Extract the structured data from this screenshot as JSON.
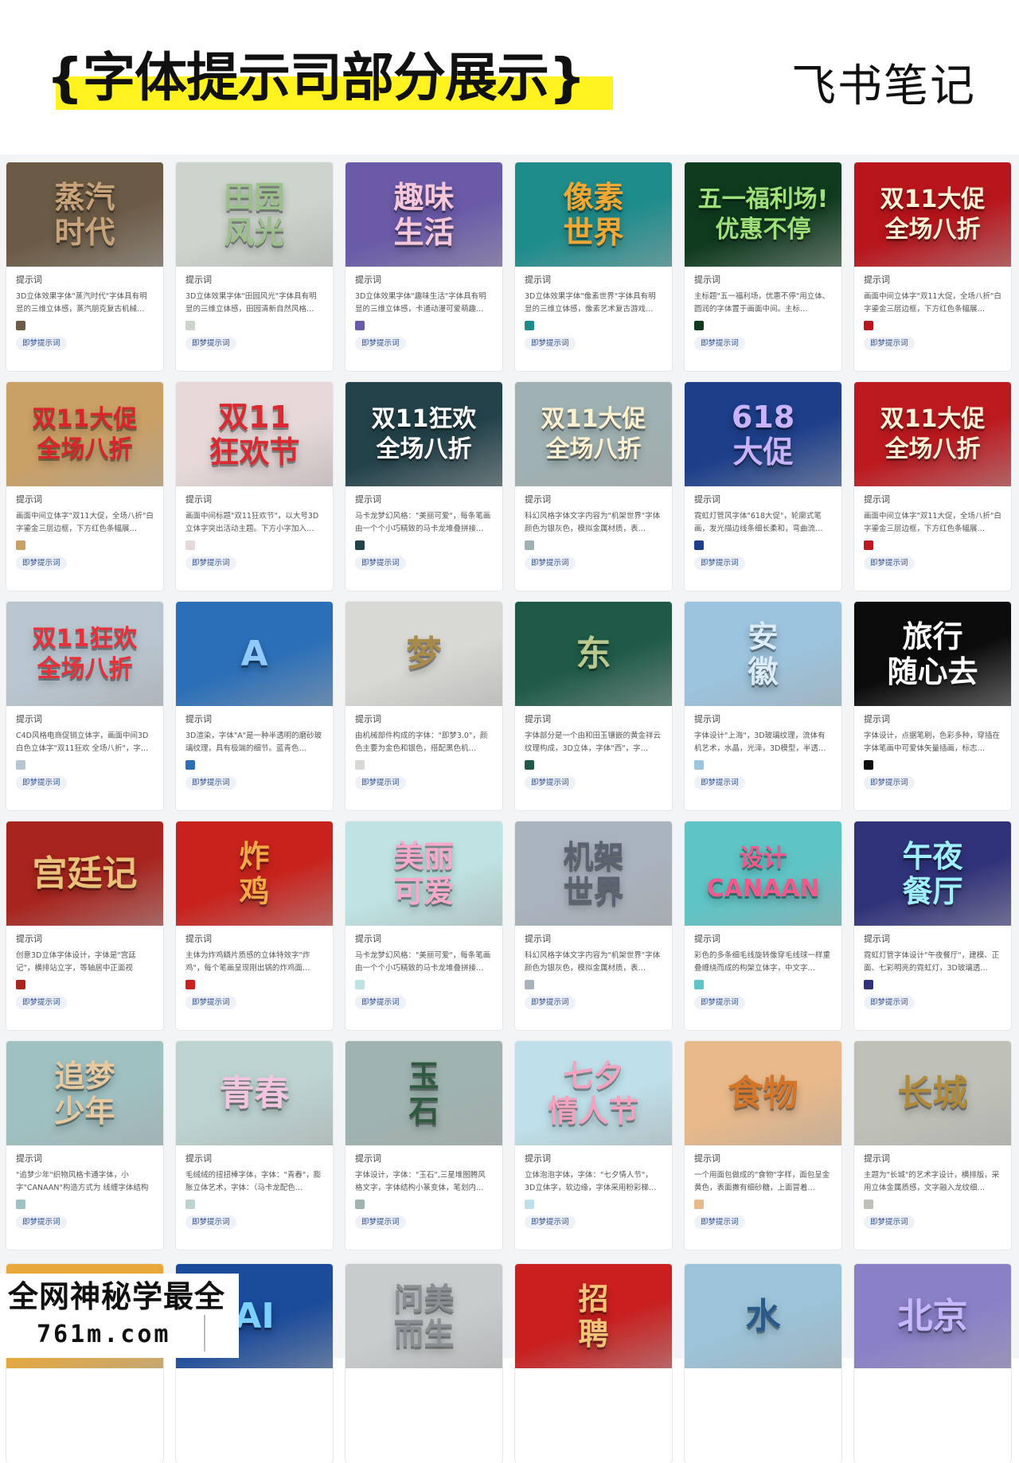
{
  "header": {
    "title": "{字体提示司部分展示}",
    "brand": "飞书笔记"
  },
  "card_label": "提示词",
  "tag_label": "即梦提示词",
  "cards": [
    {
      "thumb": "蒸汽\n时代",
      "bg": "#6b5a45",
      "fg": "#c9a37a",
      "desc": "3D立体效果字体\"蒸汽时代\"字体具有明显的三维立体感，蒸汽朋克复古机械…"
    },
    {
      "thumb": "田园\n风光",
      "bg": "#cdd4cc",
      "fg": "#9cc08c",
      "desc": "3D立体效果字体\"田园风光\"字体具有明显的三维立体感，田园清新自然风格…"
    },
    {
      "thumb": "趣味\n生活",
      "bg": "#6a5aa8",
      "fg": "#f6c7d8",
      "desc": "3D立体效果字体\"趣味生活\"字体具有明显的三维立体感，卡通动漫可爱萌趣…"
    },
    {
      "thumb": "像素\n世界",
      "bg": "#1f8c8c",
      "fg": "#f2a934",
      "desc": "3D立体效果字体\"像素世界\"字体具有明显的三维立体感，像素艺术复古游戏…"
    },
    {
      "thumb": "五一福利场!\n优惠不停",
      "bg": "#0f3a1e",
      "fg": "#9fe07a",
      "desc": "主标题\"五一福利场，优惠不停\"用立体、圆润的字体置于画面中间。主标…"
    },
    {
      "thumb": "双11大促\n全场八折",
      "bg": "#b8151c",
      "fg": "#fff2d6",
      "desc": "画面中间立体字\"双11大促，全场八折\"白字鎏金三层边框，下方红色条幅展…"
    },
    {
      "thumb": "双11大促\n全场八折",
      "bg": "#c9a066",
      "fg": "#d8242a",
      "desc": "画面中间立体字\"双11大促，全场八折\"白字鎏金三层边框，下方红色条幅展…"
    },
    {
      "thumb": "双11\n狂欢节",
      "bg": "#e7d9d9",
      "fg": "#d82a30",
      "desc": "画面中间标题\"双11狂欢节\"，以大号3D立体字突出活动主题。下方小字加入…"
    },
    {
      "thumb": "双11狂欢\n全场八折",
      "bg": "#23424a",
      "fg": "#ffffff",
      "desc": "马卡龙梦幻风格：\"美丽可爱\"，每条笔画由一个个小巧精致的马卡龙堆叠拼接…"
    },
    {
      "thumb": "双11大促\n全场八折",
      "bg": "#9fb1b2",
      "fg": "#fff1d0",
      "desc": "科幻风格字体文字内容为\"机架世界\"字体颜色为银灰色，模拟金属材质，表…"
    },
    {
      "thumb": "618\n大促",
      "bg": "#1d3f8a",
      "fg": "#c9b3ff",
      "desc": "霓虹灯管风字体\"618大促\"，轮廓式笔画，发光描边线条细长柔和，弯曲流…"
    },
    {
      "thumb": "双11大促\n全场八折",
      "bg": "#bd1a20",
      "fg": "#fff2d6",
      "desc": "画面中间立体字\"双11大促，全场八折\"白字鎏金三层边框，下方红色条幅展…"
    },
    {
      "thumb": "双11狂欢\n全场八折",
      "bg": "#b9c6d0",
      "fg": "#e7313a",
      "desc": "C4D风格电商促销立体字，画面中间3D白色立体字\"双11狂欢 全场八折\"，字…"
    },
    {
      "thumb": "A",
      "bg": "#2a6fb8",
      "fg": "#8fcbff",
      "desc": "3D渲染，字体\"A\"是一种半透明的磨砂玻璃纹理，具有极端的细节。蓝青色…"
    },
    {
      "thumb": "梦",
      "bg": "#d8d8d4",
      "fg": "#a88a4a",
      "desc": "由机械部件构成的字体：\"即梦3.0\"，颜色主要为金色和银色，搭配黑色机…"
    },
    {
      "thumb": "东",
      "bg": "#1f5a48",
      "fg": "#b9c98e",
      "desc": "字体部分是一个由和田玉镶嵌的黄金祥云纹理构成，3D立体，字体\"西\"，字…"
    },
    {
      "thumb": "安\n徽",
      "bg": "#9cc4de",
      "fg": "#dcecf8",
      "desc": "字体设计\"上海\"，3D玻璃纹理，流体有机艺术，水晶，光泽，3D模型，半透…"
    },
    {
      "thumb": "旅行\n随心去",
      "bg": "#0c0c0c",
      "fg": "#ffffff",
      "desc": "字体设计，点据笔刷，色彩多种，穿插在字体笔画中可爱体矢量插画，标志…"
    },
    {
      "thumb": "宫廷记",
      "bg": "#a8241e",
      "fg": "#e8c27a",
      "desc": "创意3D立体字体设计，字体是\"宫廷记\"，横排站立字，等轴居中正面视图，…"
    },
    {
      "thumb": "炸\n鸡",
      "bg": "#c9221c",
      "fg": "#f2a94a",
      "desc": "主体为炸鸡鳞片质感的立体特效字\"炸鸡\"，每个笔画呈现刚出锅的炸鸡面…"
    },
    {
      "thumb": "美丽\n可爱",
      "bg": "#bfe3e3",
      "fg": "#f6a9c8",
      "desc": "马卡龙梦幻风格：\"美丽可爱\"，每条笔画由一个个小巧精致的马卡龙堆叠拼接…"
    },
    {
      "thumb": "机架\n世界",
      "bg": "#a9b3be",
      "fg": "#5a6470",
      "desc": "科幻风格字体文字内容为\"机架世界\"字体颜色为银灰色，模拟金属材质，表…"
    },
    {
      "thumb": "设计\nCANAAN",
      "bg": "#5fc4c6",
      "fg": "#ef5a8a",
      "desc": "彩色的多条细毛线旋转像穿毛线球一样重叠缠绕而成的构架立体字，中文字…"
    },
    {
      "thumb": "午夜\n餐厅",
      "bg": "#30327a",
      "fg": "#9ff0ff",
      "desc": "霓虹灯管字体设计\"午夜餐厅\"，建模、正面、七彩明亮的霓虹灯，3D玻璃透…"
    },
    {
      "thumb": "追梦\n少年",
      "bg": "#9fc1c2",
      "fg": "#e8c9a0",
      "desc": "\"追梦少年\"织物风格卡通字体，小字\"CANAAN\"构造方式为 线缠字体结构 …"
    },
    {
      "thumb": "青春",
      "bg": "#bcd3d0",
      "fg": "#f2c6e0",
      "desc": "毛绒绒的扭扭棒字体，字体：\"青春\"，膨胀立体艺术，字体：（马卡龙配色…"
    },
    {
      "thumb": "玉\n石",
      "bg": "#9fb3b0",
      "fg": "#2e5a40",
      "desc": "字体设计，字体：\"玉石\",三星堆图腾风格文字，字体结构小篆变体，笔划内…"
    },
    {
      "thumb": "七夕\n情人节",
      "bg": "#bfe0ea",
      "fg": "#f4a3bf",
      "desc": "立体泡泡字体，字体：\"七夕情人节\"，3D立体字，软边缘，字体采用粉彩梯…"
    },
    {
      "thumb": "食物",
      "bg": "#e8b98a",
      "fg": "#d4752a",
      "desc": "一个用面包做成的\"食物\"字样，面包呈金黄色，表面撒有细砂糖，上面冒着…"
    },
    {
      "thumb": "长城",
      "bg": "#bfc1b8",
      "fg": "#b08a3a",
      "desc": "主题为\"长城\"的艺术字设计，横排版，采用立体金属质感，文字融入龙纹细…"
    },
    {
      "thumb": "",
      "bg": "#e8a83a",
      "fg": "#ffffff",
      "desc": ""
    },
    {
      "thumb": "AI",
      "bg": "#1a4a9a",
      "fg": "#7ad0ff",
      "desc": ""
    },
    {
      "thumb": "问美\n而生",
      "bg": "#c8cccd",
      "fg": "#8a8f93",
      "desc": ""
    },
    {
      "thumb": "招\n聘",
      "bg": "#c91f1f",
      "fg": "#f2c47a",
      "desc": ""
    },
    {
      "thumb": "水",
      "bg": "#9cc3d8",
      "fg": "#2a5a8a",
      "desc": ""
    },
    {
      "thumb": "北京",
      "bg": "#8a80c8",
      "fg": "#c8b8ff",
      "desc": ""
    }
  ],
  "watermark": {
    "line1": "全网神秘学最全",
    "line2": "761m.com"
  }
}
